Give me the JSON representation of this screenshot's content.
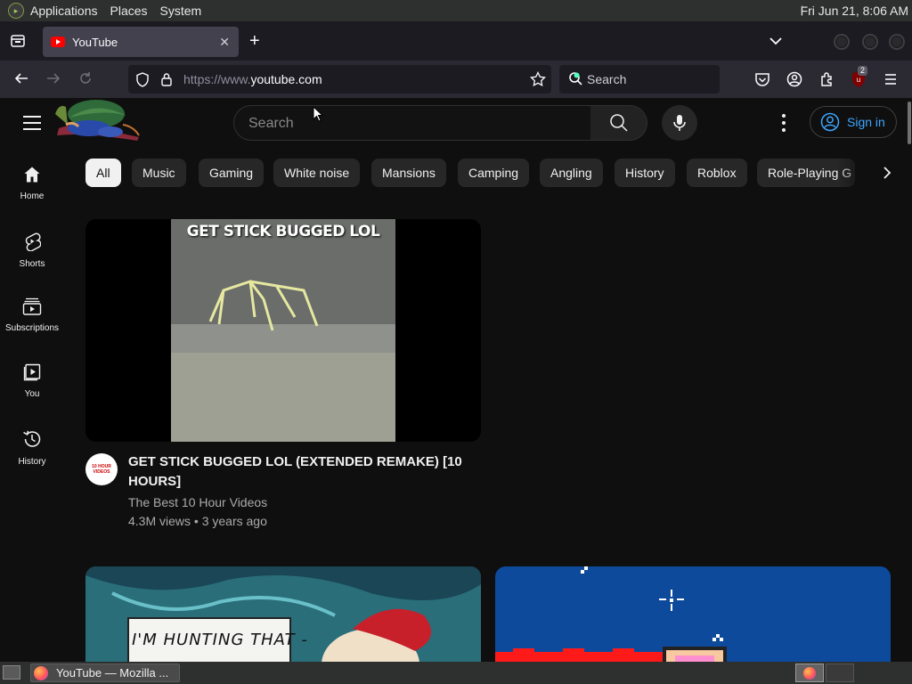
{
  "top_panel": {
    "menus": [
      "Applications",
      "Places",
      "System"
    ],
    "clock": "Fri Jun 21,  8:06 AM"
  },
  "browser": {
    "tab": {
      "title": "YouTube"
    },
    "url_prefix": "https://www.",
    "url_domain": "youtube.com",
    "search_placeholder": "Search",
    "ublock_count": "2"
  },
  "youtube": {
    "search_placeholder": "Search",
    "sign_in": "Sign in",
    "guide": [
      {
        "label": "Home",
        "icon": "home-icon"
      },
      {
        "label": "Shorts",
        "icon": "shorts-icon"
      },
      {
        "label": "Subscriptions",
        "icon": "subscriptions-icon"
      },
      {
        "label": "You",
        "icon": "you-icon"
      },
      {
        "label": "History",
        "icon": "history-icon"
      }
    ],
    "chips": [
      "All",
      "Music",
      "Gaming",
      "White noise",
      "Mansions",
      "Camping",
      "Angling",
      "History",
      "Roblox",
      "Role-Playing G"
    ],
    "videos": [
      {
        "thumb_caption": "GET STICK BUGGED LOL",
        "title": "GET STICK BUGGED LOL (EXTENDED REMAKE) [10 HOURS]",
        "channel": "The Best 10 Hour Videos",
        "meta": "4.3M views • 3 years ago",
        "avatar_text": "10 HOUR VIDEOS"
      },
      {
        "thumb_caption": "I'M HUNTING THAT -"
      },
      {
        "thumb_caption": ""
      }
    ]
  },
  "taskbar": {
    "window_title": "YouTube — Mozilla ..."
  },
  "colors": {
    "yt_bg": "#0f0f0f",
    "chip_bg": "#272727",
    "link_blue": "#3ea6ff",
    "panel_bg": "#2e2f2f",
    "ff_toolbar": "#2b2a33",
    "ff_tabstrip": "#1c1b22"
  }
}
